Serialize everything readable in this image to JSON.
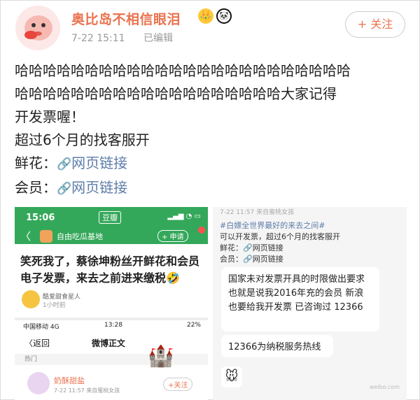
{
  "header": {
    "username": "奥比岛不相信眼泪",
    "time": "7-22 15:11",
    "edited": "已编辑",
    "follow_label": "+ 关注",
    "crown_badge": "👑",
    "panda_badge": "🐼"
  },
  "post": {
    "line1": "哈哈哈哈哈哈哈哈哈哈哈哈哈哈哈哈哈哈哈哈哈哈哈哈",
    "line2": "哈哈哈哈哈哈哈哈哈哈哈哈哈哈哈哈哈哈哈大家记得",
    "line3": "开发票喔！",
    "line4": "超过6个月的找客服开",
    "flower_label": "鲜花：",
    "member_label": "会员：",
    "link_text": "网页链接",
    "link_icon": "🔗"
  },
  "image1": {
    "time": "15:06",
    "app_tag": "豆瓣",
    "group_name": "自由吃瓜基地",
    "apply": "+ 申请",
    "headline": "笑死我了，蔡徐坤粉丝开鲜花和会员电子发票，来去之前进来缴税🤣",
    "author": "酷爱甜食星人",
    "author_time": "1小时前",
    "carrier": "中国移动 4G",
    "clock2": "13:28",
    "battery": "22%",
    "back": "〈返回",
    "title2": "微博正文",
    "hot": "热门",
    "user2": "奶酥甜盐",
    "user2_time": "7-22 11:57  来自蜜桃女孩",
    "follow2": "+关注"
  },
  "image2": {
    "top_meta": "7-22 11:57  来自蜜桃女孩",
    "tag": "#白嫖全世界最好的来去之间#",
    "line1": "可以开发票，超过6个月的找客服开",
    "line2": "鲜花：🔗网页链接",
    "line3": "会员：🔗网页链接",
    "bubble1": "国家未对发票开具的时限做出要求 也就是说我2016年充的会员 新浪也要给我开发票 已咨询过 12366",
    "bubble2": "12366为纳税服务热线",
    "watermark": "weibo.com"
  }
}
